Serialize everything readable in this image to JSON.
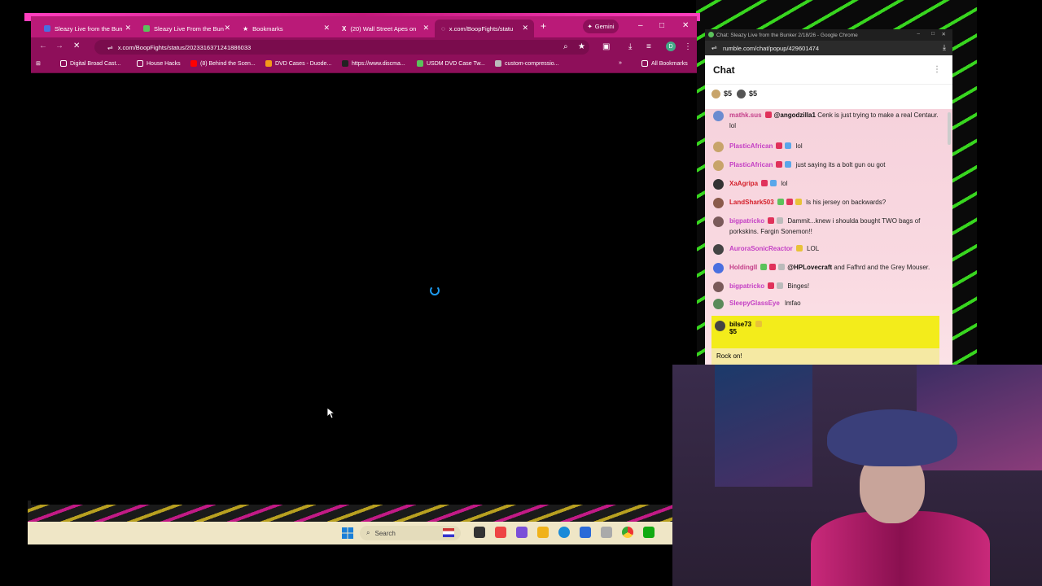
{
  "browser": {
    "tabs": [
      {
        "label": "Sleazy Live from the Bun",
        "active": false
      },
      {
        "label": "Sleazy Live From the Bun",
        "active": false
      },
      {
        "label": "Bookmarks",
        "active": false
      },
      {
        "label": "(20) Wall Street Apes on",
        "active": false
      },
      {
        "label": "x.com/BoopFights/statu",
        "active": true
      }
    ],
    "new_tab": "+",
    "gemini_label": "Gemini",
    "url": "x.com/BoopFights/status/2023316371241886033",
    "bookmarks": [
      "Digital Broad Cast...",
      "House Hacks",
      "(8) Behind the Scen...",
      "DVD Cases - Duode...",
      "https://www.discma...",
      "USDM DVD Case Tw...",
      "custom-compressio..."
    ],
    "more_bookmarks": "»",
    "all_bookmarks": "All Bookmarks",
    "window_controls": {
      "minimize": "–",
      "maximize": "□",
      "close": "✕"
    }
  },
  "chat_window": {
    "title": "Chat: Sleazy Live from the Bunker 2/18/26 - Google Chrome",
    "url": "rumble.com/chat/popup/429601474",
    "header": "Chat",
    "rants": [
      {
        "amount": "$5"
      },
      {
        "amount": "$5"
      }
    ],
    "messages": [
      {
        "user": "mathk.sus",
        "mention": "@angodzilla1",
        "text": "Cenk is just trying to make a real Centaur. lol"
      },
      {
        "user": "PlasticAfrican",
        "mention": "",
        "text": "lol"
      },
      {
        "user": "PlasticAfrican",
        "mention": "",
        "text": "just saying its a bolt gun ou got"
      },
      {
        "user": "XaAgripa",
        "mention": "",
        "text": "lol"
      },
      {
        "user": "LandShark503",
        "mention": "",
        "text": "Is his jersey on backwards?"
      },
      {
        "user": "bigpatricko",
        "mention": "",
        "text": "Dammit...knew i shoulda bought TWO bags of porkskins. Fargin Sonemon!!"
      },
      {
        "user": "AuroraSonicReactor",
        "mention": "",
        "text": "LOL"
      },
      {
        "user": "HoldingII",
        "mention": "@HPLovecraft",
        "text": "and Fafhrd and the Grey Mouser."
      },
      {
        "user": "bigpatricko",
        "mention": "",
        "text": "Binges!"
      },
      {
        "user": "SleepyGlassEye",
        "mention": "",
        "text": "lmfao"
      }
    ],
    "rant_message": {
      "user": "bilse73",
      "amount": "$5",
      "text": "Rock on!"
    }
  },
  "taskbar": {
    "search_placeholder": "Search"
  },
  "colors": {
    "browser_frame": "#ba1a78",
    "chat_highlight": "#f3ec1b",
    "taskbar": "#efe6c6"
  }
}
